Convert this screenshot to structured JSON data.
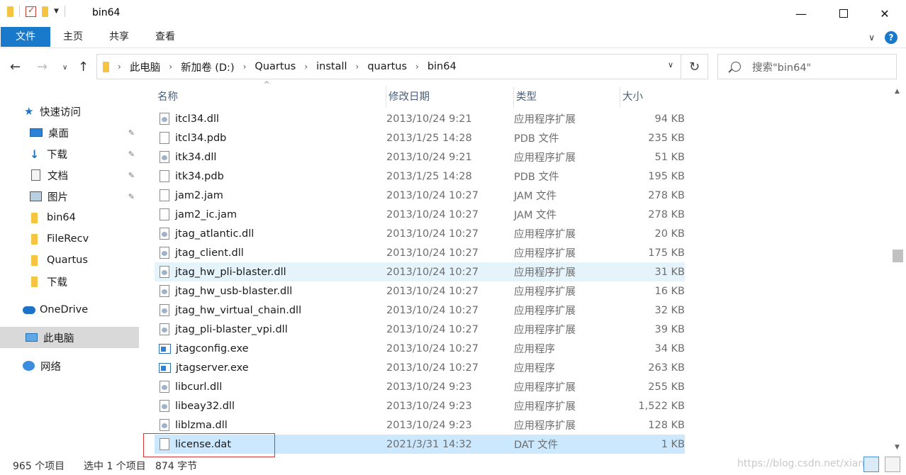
{
  "window": {
    "title": "bin64",
    "minimize": "—",
    "close": "✕"
  },
  "ribbon": {
    "tabs": [
      "文件",
      "主页",
      "共享",
      "查看"
    ],
    "collapse": "∨",
    "help": "?"
  },
  "nav": {
    "back": "←",
    "forward": "→",
    "recent": "∨",
    "up": "↑",
    "breadcrumb": [
      "此电脑",
      "新加卷 (D:)",
      "Quartus",
      "install",
      "quartus",
      "bin64"
    ],
    "crumb_sep": "›",
    "address_dropdown": "∨",
    "refresh": "↻",
    "search_placeholder": "搜索\"bin64\""
  },
  "sidebar": {
    "items": [
      {
        "label": "快速访问",
        "icon": "star-icon"
      },
      {
        "label": "桌面",
        "icon": "desktop-icon",
        "pinned": true
      },
      {
        "label": "下载",
        "icon": "download-icon",
        "pinned": true
      },
      {
        "label": "文档",
        "icon": "document-icon",
        "pinned": true
      },
      {
        "label": "图片",
        "icon": "pictures-icon",
        "pinned": true
      },
      {
        "label": "bin64",
        "icon": "folder-icon"
      },
      {
        "label": "FileRecv",
        "icon": "folder-icon"
      },
      {
        "label": "Quartus",
        "icon": "folder-icon"
      },
      {
        "label": "下载",
        "icon": "folder-icon"
      },
      {
        "label": "OneDrive",
        "icon": "cloud-icon"
      },
      {
        "label": "此电脑",
        "icon": "computer-icon",
        "selected": true
      },
      {
        "label": "网络",
        "icon": "network-icon"
      }
    ],
    "pin_glyph": "📌"
  },
  "columns": {
    "name": "名称",
    "date": "修改日期",
    "type": "类型",
    "size": "大小",
    "sort_indicator": "^"
  },
  "files": [
    {
      "name": "itcl34.dll",
      "date": "2013/10/24 9:21",
      "type": "应用程序扩展",
      "size": "94 KB",
      "kind": "dll"
    },
    {
      "name": "itcl34.pdb",
      "date": "2013/1/25 14:28",
      "type": "PDB 文件",
      "size": "235 KB",
      "kind": "file"
    },
    {
      "name": "itk34.dll",
      "date": "2013/10/24 9:21",
      "type": "应用程序扩展",
      "size": "51 KB",
      "kind": "dll"
    },
    {
      "name": "itk34.pdb",
      "date": "2013/1/25 14:28",
      "type": "PDB 文件",
      "size": "195 KB",
      "kind": "file"
    },
    {
      "name": "jam2.jam",
      "date": "2013/10/24 10:27",
      "type": "JAM 文件",
      "size": "278 KB",
      "kind": "file"
    },
    {
      "name": "jam2_ic.jam",
      "date": "2013/10/24 10:27",
      "type": "JAM 文件",
      "size": "278 KB",
      "kind": "file"
    },
    {
      "name": "jtag_atlantic.dll",
      "date": "2013/10/24 10:27",
      "type": "应用程序扩展",
      "size": "20 KB",
      "kind": "dll"
    },
    {
      "name": "jtag_client.dll",
      "date": "2013/10/24 10:27",
      "type": "应用程序扩展",
      "size": "175 KB",
      "kind": "dll"
    },
    {
      "name": "jtag_hw_pli-blaster.dll",
      "date": "2013/10/24 10:27",
      "type": "应用程序扩展",
      "size": "31 KB",
      "kind": "dll",
      "state": "hover"
    },
    {
      "name": "jtag_hw_usb-blaster.dll",
      "date": "2013/10/24 10:27",
      "type": "应用程序扩展",
      "size": "16 KB",
      "kind": "dll"
    },
    {
      "name": "jtag_hw_virtual_chain.dll",
      "date": "2013/10/24 10:27",
      "type": "应用程序扩展",
      "size": "32 KB",
      "kind": "dll"
    },
    {
      "name": "jtag_pli-blaster_vpi.dll",
      "date": "2013/10/24 10:27",
      "type": "应用程序扩展",
      "size": "39 KB",
      "kind": "dll"
    },
    {
      "name": "jtagconfig.exe",
      "date": "2013/10/24 10:27",
      "type": "应用程序",
      "size": "34 KB",
      "kind": "exe"
    },
    {
      "name": "jtagserver.exe",
      "date": "2013/10/24 10:27",
      "type": "应用程序",
      "size": "263 KB",
      "kind": "exe"
    },
    {
      "name": "libcurl.dll",
      "date": "2013/10/24 9:23",
      "type": "应用程序扩展",
      "size": "255 KB",
      "kind": "dll"
    },
    {
      "name": "libeay32.dll",
      "date": "2013/10/24 9:23",
      "type": "应用程序扩展",
      "size": "1,522 KB",
      "kind": "dll"
    },
    {
      "name": "liblzma.dll",
      "date": "2013/10/24 9:23",
      "type": "应用程序扩展",
      "size": "128 KB",
      "kind": "dll"
    },
    {
      "name": "license.dat",
      "date": "2021/3/31 14:32",
      "type": "DAT 文件",
      "size": "1 KB",
      "kind": "file",
      "state": "selected"
    }
  ],
  "status": {
    "item_count": "965 个项目",
    "selection": "选中 1 个项目",
    "selection_size": "874 字节",
    "watermark": "https://blog.csdn.net/xiany..."
  },
  "colors": {
    "accent": "#1979ca",
    "selection": "#cce8ff",
    "hover": "#e5f3fb",
    "highlight_box": "#d9383a"
  }
}
